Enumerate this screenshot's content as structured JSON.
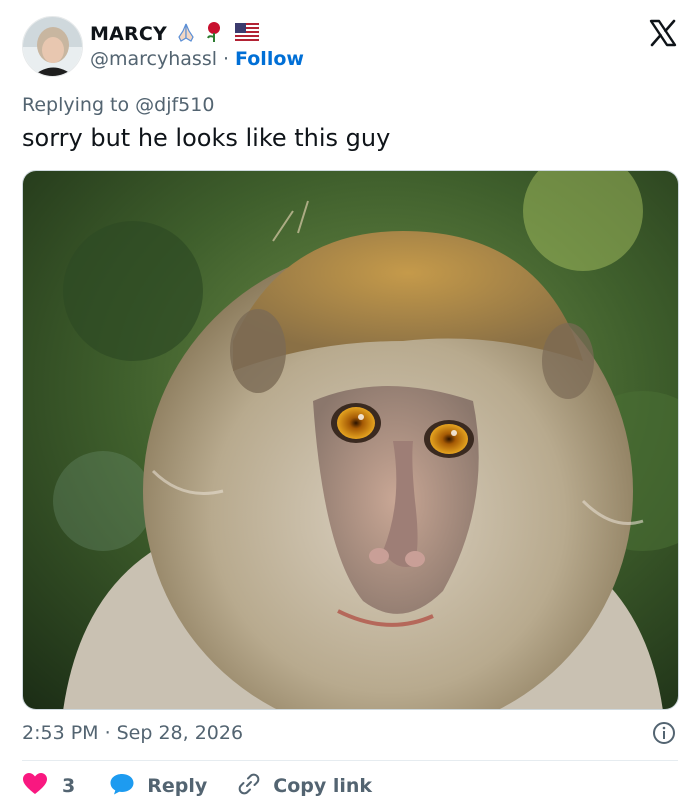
{
  "author": {
    "display_name": "MARCY",
    "name_emojis": [
      "praying-hands",
      "rose",
      "us-flag"
    ],
    "handle": "@marcyhassl",
    "separator": "·",
    "follow_label": "Follow"
  },
  "reply_context": {
    "prefix": "Replying to ",
    "mention": "@djf510"
  },
  "tweet": {
    "text": "sorry but he looks like this guy",
    "media_alt": "Close-up photo of a long-tailed macaque monkey with amber eyes against a green blurred background",
    "time": "2:53 PM",
    "separator": "·",
    "date": "Sep 28, 2026"
  },
  "actions": {
    "like_count": "3",
    "reply_label": "Reply",
    "copy_link_label": "Copy link"
  },
  "colors": {
    "text": "#0f1419",
    "secondary": "#536471",
    "follow_link": "#006fd6",
    "like_heart": "#f91880",
    "reply_bubble": "#1d9bf0"
  },
  "icons": {
    "brand": "x-logo-icon",
    "info": "info-icon",
    "like": "heart-icon",
    "reply": "speech-bubble-icon",
    "copy": "link-icon"
  }
}
